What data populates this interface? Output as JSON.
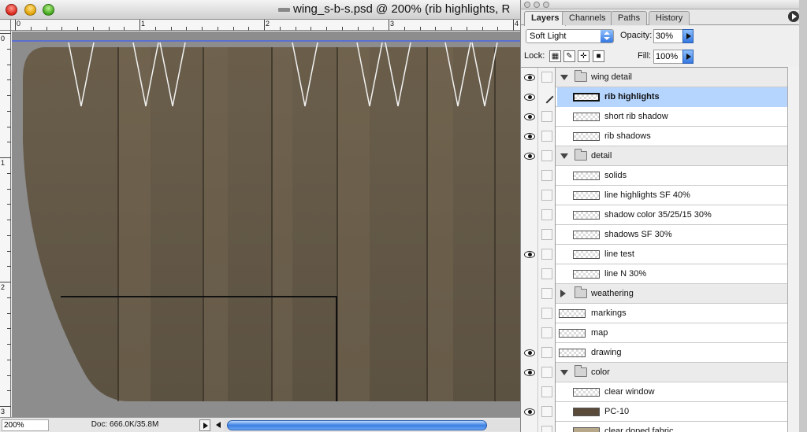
{
  "window": {
    "title": "wing_s-b-s.psd @ 200% (rib highlights, R"
  },
  "rulers": {
    "horizontal_labels": [
      "0",
      "1",
      "2",
      "3",
      "4"
    ],
    "vertical_labels": [
      "0",
      "1",
      "2",
      "3"
    ]
  },
  "status": {
    "zoom": "200%",
    "doc_info": "Doc: 666.0K/35.8M"
  },
  "palette": {
    "tabs": [
      {
        "label": "Layers",
        "active": true
      },
      {
        "label": "Channels",
        "active": false
      },
      {
        "label": "Paths",
        "active": false
      },
      {
        "label": "History",
        "active": false
      }
    ],
    "blend_mode": "Soft Light",
    "opacity_label": "Opacity:",
    "opacity_value": "30%",
    "lock_label": "Lock:",
    "fill_label": "Fill:",
    "fill_value": "100%"
  },
  "layers": [
    {
      "name": "wing detail",
      "type": "group",
      "expanded": true,
      "visible": true,
      "indent": 0
    },
    {
      "name": "rib highlights",
      "type": "layer",
      "visible": true,
      "indent": 1,
      "selected": true,
      "thumb": "checker"
    },
    {
      "name": "short rib shadow",
      "type": "layer",
      "visible": true,
      "indent": 1,
      "thumb": "checker"
    },
    {
      "name": "rib shadows",
      "type": "layer",
      "visible": true,
      "indent": 1,
      "thumb": "checker"
    },
    {
      "name": "detail",
      "type": "group",
      "expanded": true,
      "visible": true,
      "indent": 0
    },
    {
      "name": "solids",
      "type": "layer",
      "visible": false,
      "indent": 1,
      "thumb": "checker"
    },
    {
      "name": "line highlights SF 40%",
      "type": "layer",
      "visible": false,
      "indent": 1,
      "thumb": "checker"
    },
    {
      "name": "shadow color 35/25/15 30%",
      "type": "layer",
      "visible": false,
      "indent": 1,
      "thumb": "checker"
    },
    {
      "name": "shadows SF 30%",
      "type": "layer",
      "visible": false,
      "indent": 1,
      "thumb": "checker"
    },
    {
      "name": "line test",
      "type": "layer",
      "visible": true,
      "indent": 1,
      "thumb": "checker"
    },
    {
      "name": "line N 30%",
      "type": "layer",
      "visible": false,
      "indent": 1,
      "thumb": "checker"
    },
    {
      "name": "weathering",
      "type": "group",
      "expanded": false,
      "visible": false,
      "indent": 0
    },
    {
      "name": "markings",
      "type": "layer",
      "visible": false,
      "indent": 0,
      "thumb": "checker"
    },
    {
      "name": "map",
      "type": "layer",
      "visible": false,
      "indent": 0,
      "thumb": "checker"
    },
    {
      "name": "drawing",
      "type": "layer",
      "visible": true,
      "indent": 0,
      "thumb": "checker"
    },
    {
      "name": "color",
      "type": "group",
      "expanded": true,
      "visible": true,
      "indent": 0
    },
    {
      "name": "clear window",
      "type": "layer",
      "visible": false,
      "indent": 1,
      "thumb": "checker"
    },
    {
      "name": "PC-10",
      "type": "layer",
      "visible": true,
      "indent": 1,
      "thumb": "dark"
    },
    {
      "name": "clear doped fabric",
      "type": "layer",
      "visible": false,
      "indent": 1,
      "thumb": "tan"
    }
  ]
}
